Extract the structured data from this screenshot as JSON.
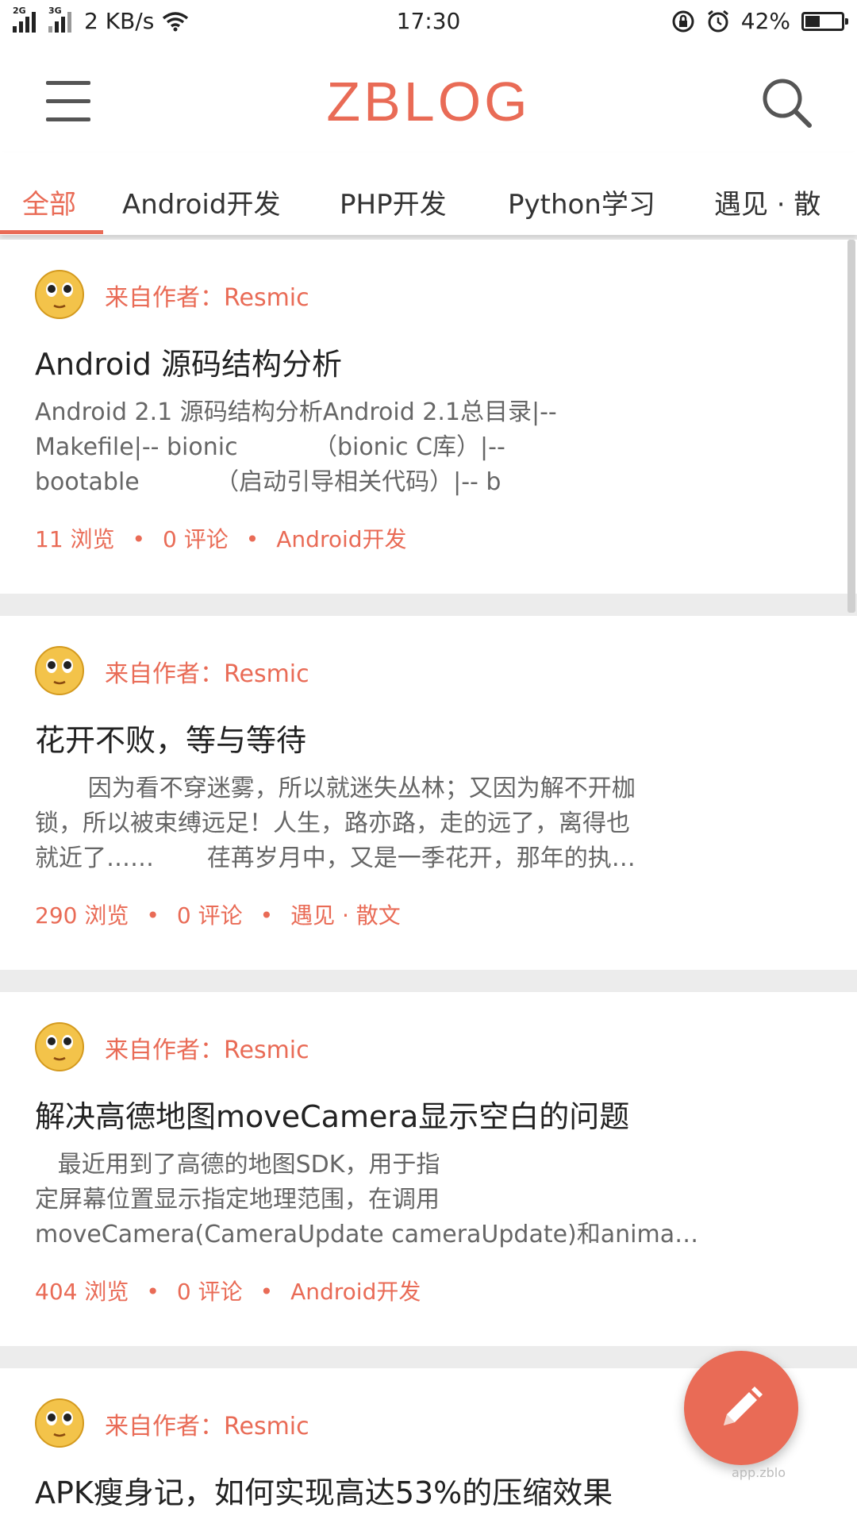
{
  "status_bar": {
    "net1": "2G",
    "net2": "3G",
    "speed": "2 KB/s",
    "time": "17:30",
    "battery": "42%",
    "battery_level": 0.42
  },
  "app_bar": {
    "title": "ZBLOG",
    "menu_icon": "menu-icon",
    "search_icon": "search-icon"
  },
  "tabs": [
    {
      "label": "全部",
      "active": true
    },
    {
      "label": "Android开发",
      "active": false
    },
    {
      "label": "PHP开发",
      "active": false
    },
    {
      "label": "Python学习",
      "active": false
    },
    {
      "label": "遇见 · 散",
      "active": false
    }
  ],
  "posts": [
    {
      "author": "来自作者：Resmic",
      "title": "Android 源码结构分析",
      "excerpt": "Android 2.1 源码结构分析Android 2.1总目录|--\nMakefile|-- bionic          （bionic C库）|--\nbootable          （启动引导相关代码）|-- b",
      "views": "11 浏览",
      "comments": "0 评论",
      "category": "Android开发"
    },
    {
      "author": "来自作者：Resmic",
      "title": "花开不败，等与等待",
      "excerpt": "       因为看不穿迷雾，所以就迷失丛林；又因为解不开枷\n锁，所以被束缚远足！人生，路亦路，走的远了，离得也\n就近了……       荏苒岁月中，又是一季花开，那年的执…",
      "views": "290 浏览",
      "comments": "0 评论",
      "category": "遇见 · 散文"
    },
    {
      "author": "来自作者：Resmic",
      "title": "解决高德地图moveCamera显示空白的问题",
      "excerpt": "   最近用到了高德的地图SDK，用于指\n定屏幕位置显示指定地理范围，在调用\nmoveCamera(CameraUpdate cameraUpdate)和anima…",
      "views": "404 浏览",
      "comments": "0 评论",
      "category": "Android开发"
    },
    {
      "author": "来自作者：Resmic",
      "title": "APK瘦身记，如何实现高达53%的压缩效果",
      "excerpt": "",
      "views": "",
      "comments": "",
      "category": ""
    }
  ],
  "meta_separator": "•",
  "fab": {
    "icon": "edit-pencil-icon"
  },
  "watermark": "app.zblo"
}
